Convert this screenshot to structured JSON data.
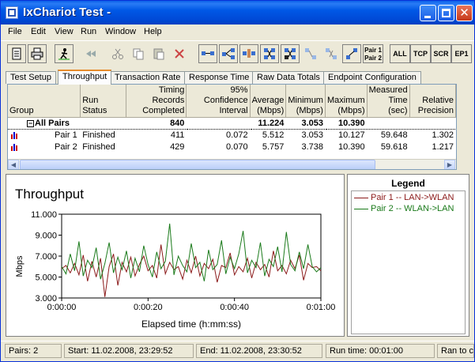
{
  "window": {
    "title": "IxChariot Test -"
  },
  "menu": [
    "File",
    "Edit",
    "View",
    "Run",
    "Window",
    "Help"
  ],
  "toolbar": {
    "icons": [
      "new-doc-icon",
      "print-icon",
      "run-icon",
      "rewind-icon",
      "cut-icon",
      "copy-icon",
      "paste-icon",
      "delete-icon",
      "pair-icon",
      "multicast-icon",
      "hardware-pair-icon",
      "edit-pair-icon",
      "rename-pair-icon",
      "replicate-icon",
      "mark-icon",
      "swap-icon"
    ],
    "pair_label_1": "Pair 1",
    "pair_label_2": "Pair 2",
    "filters": [
      "ALL",
      "TCP",
      "SCR",
      "EP1"
    ]
  },
  "tabs": [
    "Test Setup",
    "Throughput",
    "Transaction Rate",
    "Response Time",
    "Raw Data Totals",
    "Endpoint Configuration"
  ],
  "active_tab": 1,
  "grid": {
    "columns": [
      "Group",
      "Run Status",
      "Timing Records Completed",
      "95% Confidence Interval",
      "Average (Mbps)",
      "Minimum (Mbps)",
      "Maximum (Mbps)",
      "Measured Time (sec)",
      "Relative Precision"
    ],
    "summary": {
      "group": "All Pairs",
      "records": "840",
      "average": "11.224",
      "minimum": "3.053",
      "maximum": "10.390"
    },
    "rows": [
      {
        "name": "Pair 1",
        "status": "Finished",
        "records": "411",
        "ci": "0.072",
        "avg": "5.512",
        "min": "3.053",
        "max": "10.127",
        "time": "59.648",
        "precision": "1.302"
      },
      {
        "name": "Pair 2",
        "status": "Finished",
        "records": "429",
        "ci": "0.070",
        "avg": "5.757",
        "min": "3.738",
        "max": "10.390",
        "time": "59.618",
        "precision": "1.217"
      }
    ]
  },
  "chart_data": {
    "type": "line",
    "title": "Throughput",
    "xlabel": "Elapsed time (h:mm:ss)",
    "ylabel": "Mbps",
    "xlim": [
      0,
      60
    ],
    "ylim": [
      3,
      11
    ],
    "x_ticks": [
      "0:00:00",
      "0:00:20",
      "0:00:40",
      "0:01:00"
    ],
    "y_ticks": [
      "3.000",
      "5.000",
      "7.000",
      "9.000",
      "11.000"
    ],
    "legend_title": "Legend",
    "series": [
      {
        "name": "Pair 1 -- LAN->WLAN",
        "color": "#8b1a1a",
        "x": [
          0,
          1,
          2,
          3,
          4,
          5,
          6,
          7,
          8,
          9,
          10,
          11,
          12,
          13,
          14,
          15,
          16,
          17,
          18,
          19,
          20,
          21,
          22,
          23,
          24,
          25,
          26,
          27,
          28,
          29,
          30,
          31,
          32,
          33,
          34,
          35,
          36,
          37,
          38,
          39,
          40,
          41,
          42,
          43,
          44,
          45,
          46,
          47,
          48,
          49,
          50,
          51,
          52,
          53,
          54,
          55,
          56,
          57,
          58,
          59,
          60
        ],
        "y": [
          5.8,
          6.1,
          5.4,
          6.3,
          5.2,
          7.1,
          4.6,
          6.5,
          5.0,
          6.8,
          3.1,
          6.0,
          7.2,
          4.2,
          6.4,
          5.5,
          6.9,
          5.1,
          6.2,
          7.0,
          5.6,
          6.1,
          4.9,
          8.1,
          5.3,
          6.4,
          5.7,
          6.0,
          4.8,
          6.6,
          5.4,
          7.0,
          5.1,
          6.3,
          5.8,
          6.7,
          4.5,
          6.1,
          5.9,
          7.3,
          5.2,
          6.0,
          5.5,
          6.8,
          4.9,
          6.4,
          5.7,
          6.2,
          5.0,
          7.5,
          5.6,
          6.1,
          5.3,
          6.6,
          5.8,
          7.1,
          4.7,
          6.3,
          5.9,
          6.0,
          5.6
        ]
      },
      {
        "name": "Pair 2 -- WLAN->LAN",
        "color": "#1a7a1a",
        "x": [
          0,
          1,
          2,
          3,
          4,
          5,
          6,
          7,
          8,
          9,
          10,
          11,
          12,
          13,
          14,
          15,
          16,
          17,
          18,
          19,
          20,
          21,
          22,
          23,
          24,
          25,
          26,
          27,
          28,
          29,
          30,
          31,
          32,
          33,
          34,
          35,
          36,
          37,
          38,
          39,
          40,
          41,
          42,
          43,
          44,
          45,
          46,
          47,
          48,
          49,
          50,
          51,
          52,
          53,
          54,
          55,
          56,
          57,
          58,
          59,
          60
        ],
        "y": [
          6.0,
          5.3,
          7.2,
          5.6,
          8.4,
          5.1,
          6.6,
          5.9,
          7.8,
          4.8,
          6.3,
          8.3,
          5.4,
          6.9,
          5.7,
          7.5,
          4.9,
          6.8,
          5.5,
          8.0,
          6.2,
          5.0,
          7.4,
          5.8,
          6.5,
          10.1,
          5.2,
          7.0,
          6.1,
          5.5,
          8.2,
          5.9,
          6.4,
          4.6,
          7.6,
          5.7,
          6.2,
          8.5,
          5.3,
          6.9,
          5.8,
          7.2,
          9.4,
          5.4,
          6.6,
          5.9,
          8.3,
          5.1,
          6.7,
          6.0,
          7.9,
          5.5,
          9.3,
          6.2,
          5.6,
          7.4,
          5.8,
          8.1,
          6.0,
          5.5,
          5.9
        ]
      }
    ]
  },
  "status": {
    "pairs": "Pairs: 2",
    "start": "Start: 11.02.2008, 23:29:52",
    "end": "End: 11.02.2008, 23:30:52",
    "runtime": "Run time: 00:01:00",
    "ran": "Ran to c"
  }
}
